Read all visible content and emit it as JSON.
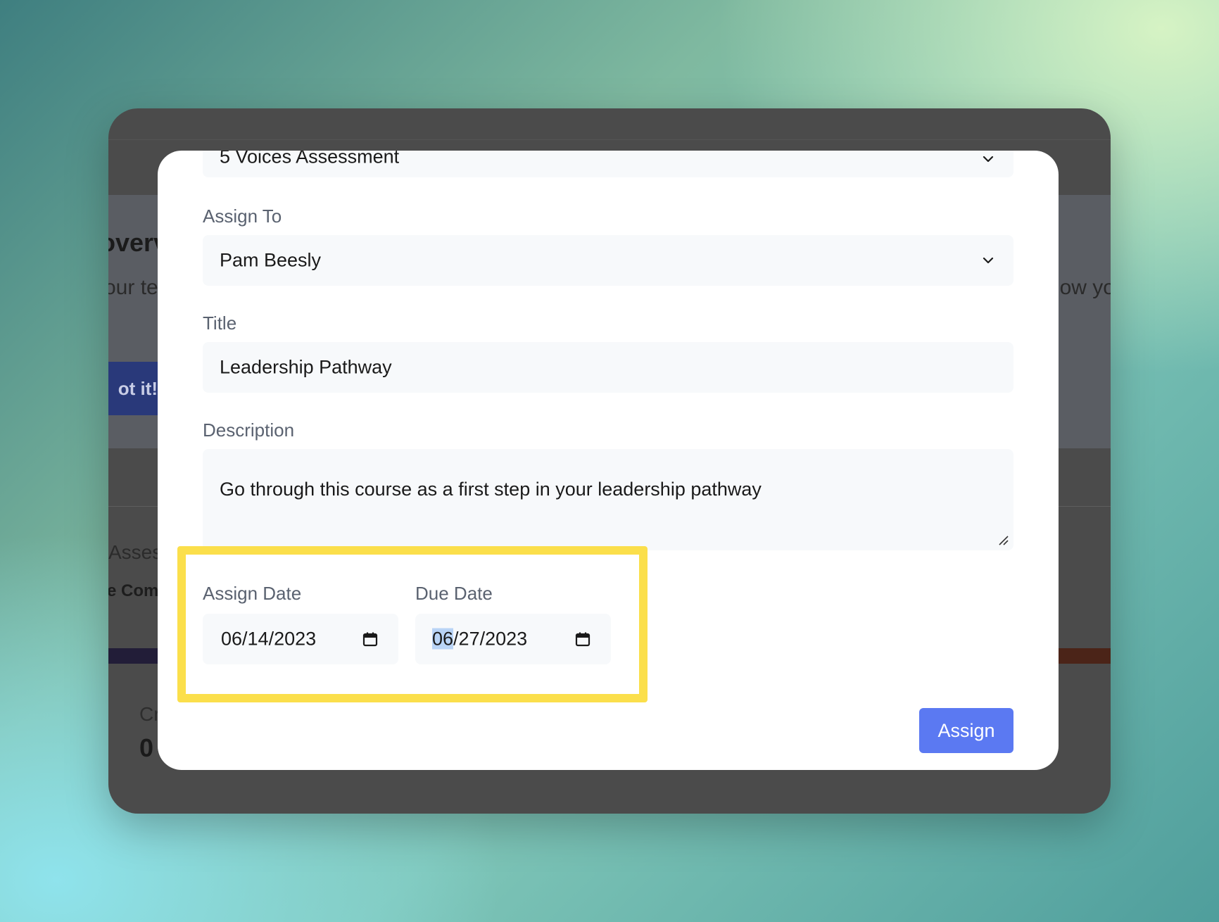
{
  "background_page": {
    "heading_fragment": "overv",
    "subtitle_fragment_left": "our te",
    "subtitle_fragment_right": "ow yo",
    "button_fragment": "ot it!",
    "assessments_fragment": "Assess",
    "completed_fragment": "e Com",
    "card_label_fragment": "Cr",
    "card_value": "0"
  },
  "modal": {
    "assessment_select": {
      "value": "5 Voices Assessment"
    },
    "assign_to": {
      "label": "Assign To",
      "value": "Pam Beesly"
    },
    "title": {
      "label": "Title",
      "value": "Leadership Pathway"
    },
    "description": {
      "label": "Description",
      "value": "Go through this course as a first step in your leadership pathway"
    },
    "assign_date": {
      "label": "Assign Date",
      "value": "06/14/2023"
    },
    "due_date": {
      "label": "Due Date",
      "month": "06",
      "rest": "/27/2023"
    },
    "assign_button": {
      "label": "Assign"
    }
  },
  "colors": {
    "accent": "#5b79f2",
    "highlight": "#fbdf4b",
    "overlay": "#4b4b4b"
  },
  "icons": {
    "select_chevron": "chevron-down-icon",
    "date_picker": "calendar-icon",
    "textarea_resize": "resize-grip-icon"
  }
}
